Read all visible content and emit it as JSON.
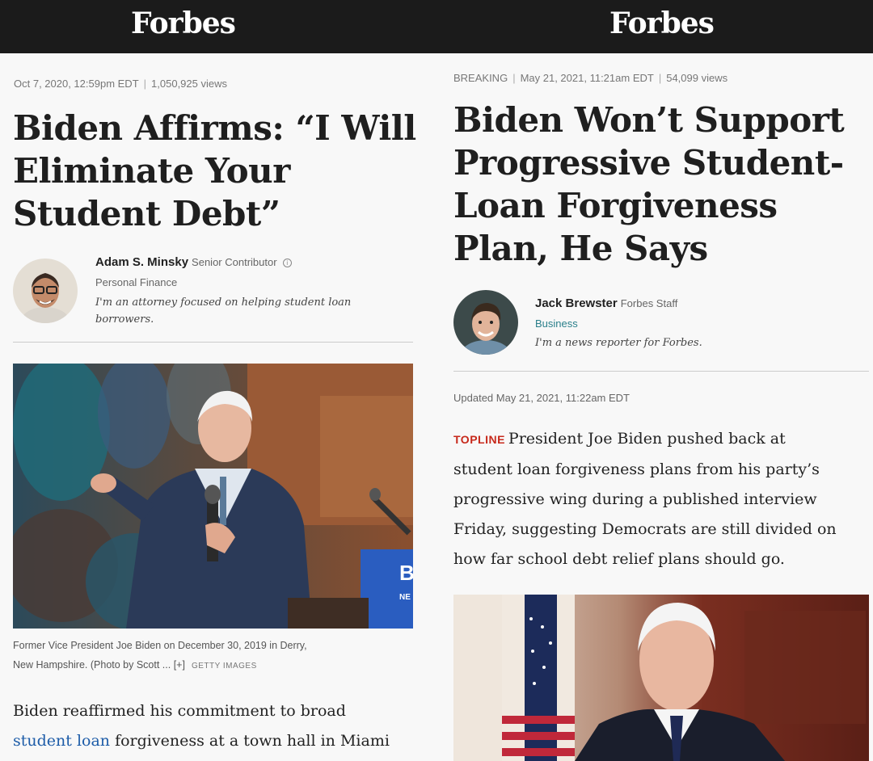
{
  "left": {
    "logo": "Forbes",
    "date": "Oct 7, 2020, 12:59pm EDT",
    "views": "1,050,925 views",
    "headline_lines": [
      "Biden Affirms: “I Will",
      "Eliminate Your",
      "Student Debt”"
    ],
    "author": {
      "name": "Adam S. Minsky",
      "role": "Senior Contributor",
      "section": "Personal Finance",
      "bio_lines": [
        "I'm an attorney focused on helping student loan",
        "borrowers."
      ]
    },
    "caption_line1": "Former Vice President Joe Biden on December 30, 2019 in Derry,",
    "caption_line2": "New Hampshire. (Photo by Scott ... [+]",
    "caption_credit": "GETTY IMAGES",
    "body_line1": "Biden reaffirmed his commitment to broad",
    "body_link": "student loan",
    "body_line2_rest": " forgiveness at a town hall in Miami"
  },
  "right": {
    "logo": "Forbes",
    "label": "BREAKING",
    "date": "May 21, 2021, 11:21am EDT",
    "views": "54,099 views",
    "headline_lines": [
      "Biden Won’t Support",
      "Progressive Student-",
      "Loan Forgiveness",
      "Plan, He Says"
    ],
    "author": {
      "name": "Jack Brewster",
      "role": "Forbes Staff",
      "section": "Business",
      "bio": "I'm a news reporter for Forbes."
    },
    "updated": "Updated May 21, 2021, 11:22am EDT",
    "topline_label": "TOPLINE",
    "topline_lines": [
      "President Joe Biden pushed back at",
      "student loan forgiveness plans from his party’s",
      "progressive wing during a published interview",
      "Friday, suggesting Democrats are still divided on",
      "how far school debt relief plans should go."
    ]
  },
  "colors": {
    "masthead": "#1b1b1b",
    "topline": "#c7291b",
    "link": "#1d5ca8",
    "section_business": "#2a7f8a"
  }
}
